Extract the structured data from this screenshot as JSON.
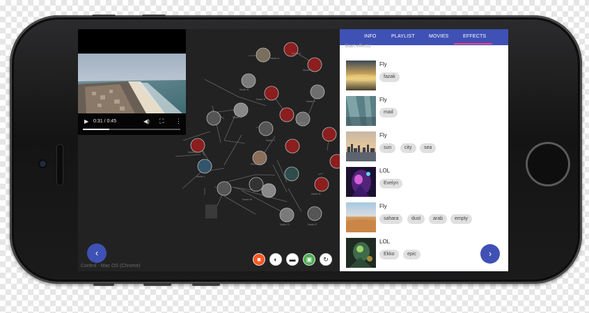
{
  "video": {
    "play_icon": "▶",
    "time": "0:31 / 0:45",
    "volume_icon": "◀)",
    "fullscreen_icon": "⛶",
    "more_icon": "⋮",
    "progress": 0.27
  },
  "footer": {
    "back_icon": "‹",
    "control_label": "Control - Mac OS (Chrome)"
  },
  "toolbar": {
    "buttons": [
      {
        "icon": "stop-icon",
        "glyph": "■",
        "color": "#ff5722"
      },
      {
        "icon": "contrast-icon",
        "glyph": "◐",
        "color": "#ffffff"
      },
      {
        "icon": "screen-icon",
        "glyph": "▬",
        "color": "#ffffff"
      },
      {
        "icon": "portrait-icon",
        "glyph": "▣",
        "color": "#4caf50"
      },
      {
        "icon": "sync-icon",
        "glyph": "↻",
        "color": "#ffffff"
      }
    ]
  },
  "panel": {
    "tabs": [
      "INFO",
      "PLAYLIST",
      "MOVIES",
      "EFFECTS"
    ],
    "active_tab": "EFFECTS",
    "search_hint": "Start effects",
    "forward_icon": "›",
    "effects": [
      {
        "title": "Fly",
        "tags": [
          "fazak"
        ],
        "thumb": "sunset-clouds"
      },
      {
        "title": "Fly",
        "tags": [
          "mad"
        ],
        "thumb": "underwater-light"
      },
      {
        "title": "Fly",
        "tags": [
          "sun",
          "city",
          "sea"
        ],
        "thumb": "city-sunset"
      },
      {
        "title": "LOL",
        "tags": [
          "Evelyn"
        ],
        "thumb": "neon-character"
      },
      {
        "title": "Fly",
        "tags": [
          "sahara",
          "dust",
          "arab",
          "empty"
        ],
        "thumb": "desert"
      },
      {
        "title": "LOL",
        "tags": [
          "Ekko",
          "epic"
        ],
        "thumb": "champion"
      }
    ]
  },
  "colors": {
    "accent": "#3f51b5",
    "tab_indicator": "#ff4081",
    "node_red": "#8b1e1e"
  }
}
